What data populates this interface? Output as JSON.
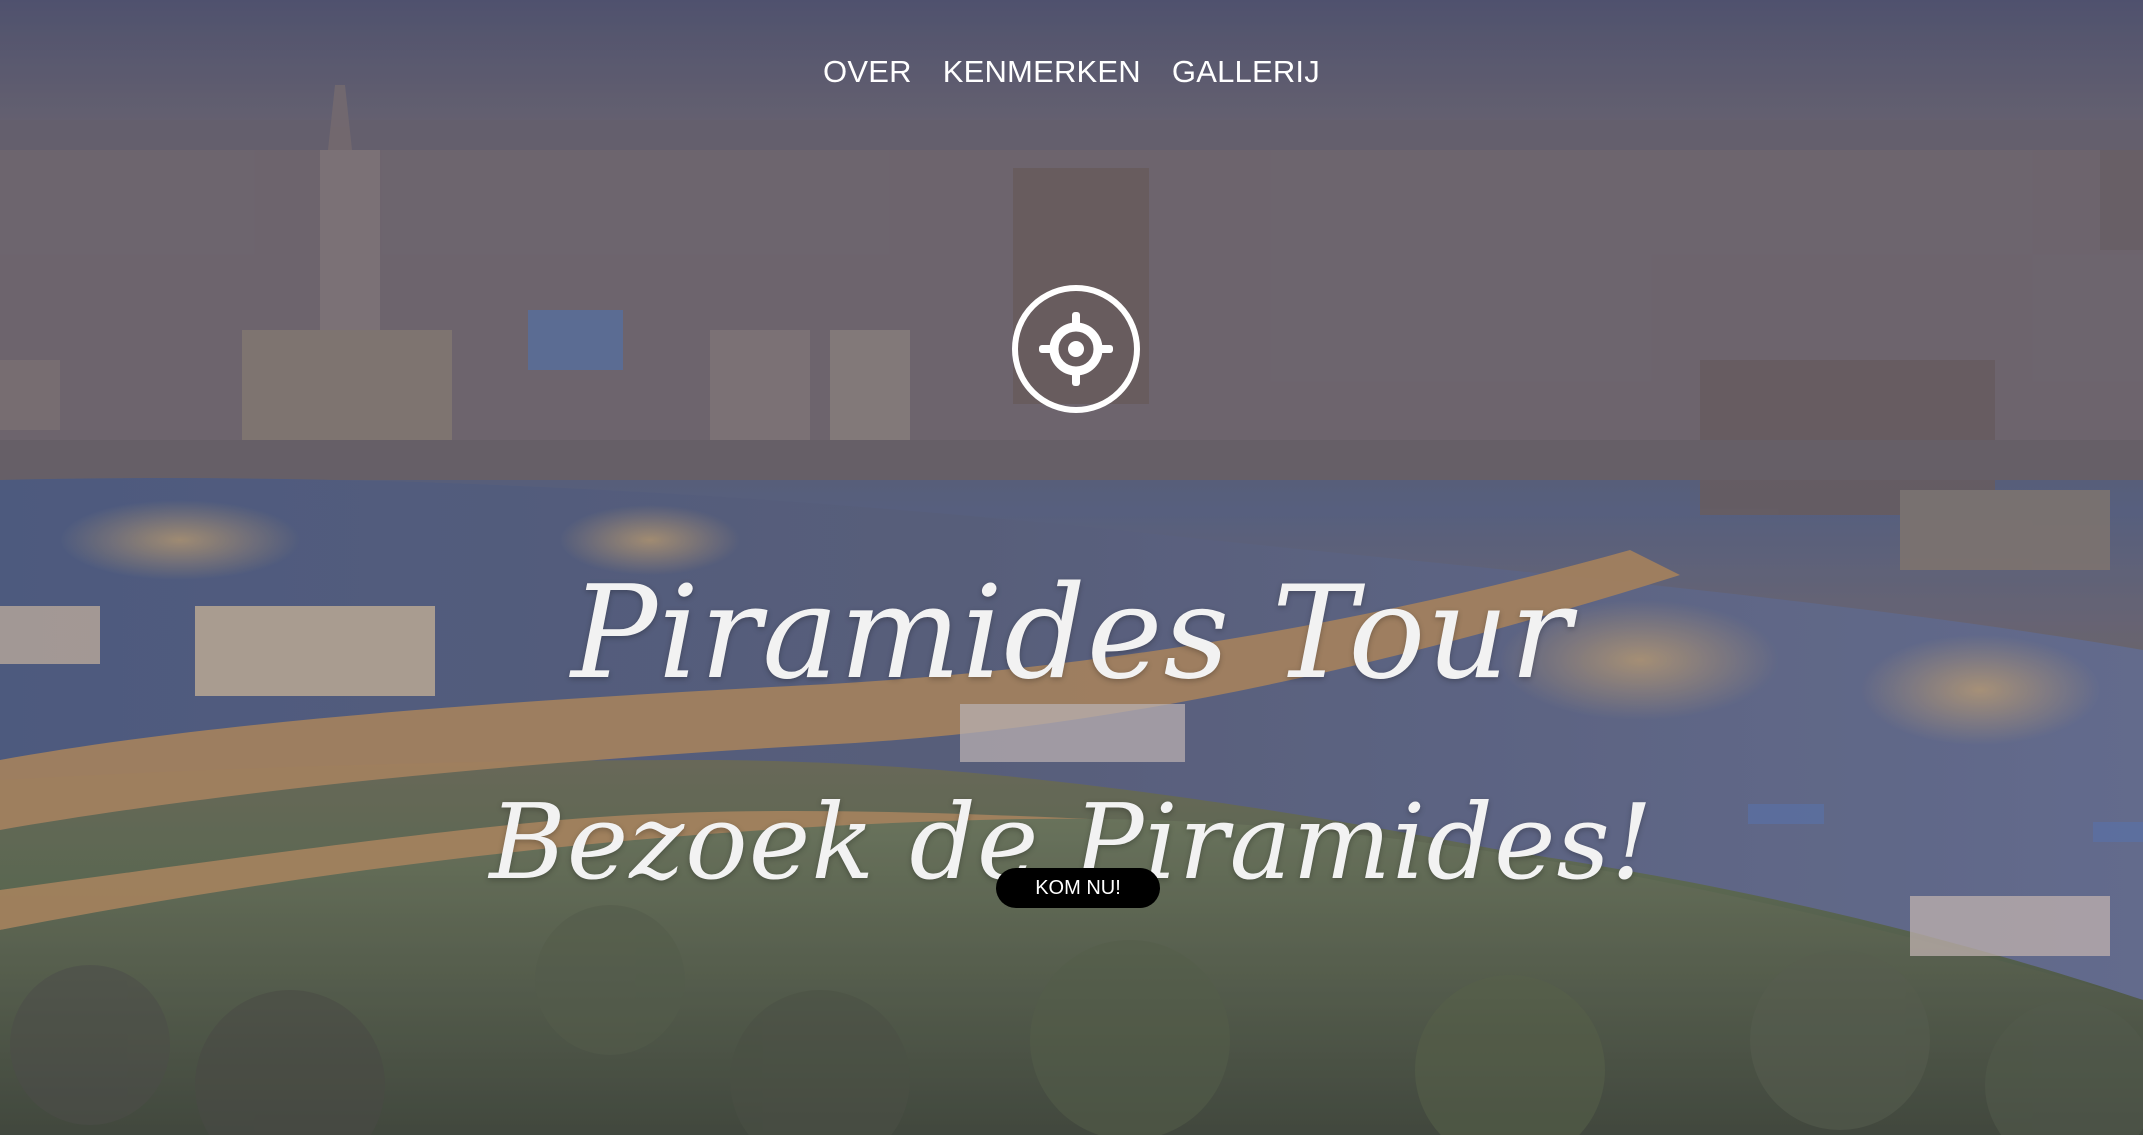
{
  "nav": {
    "items": [
      {
        "label": "OVER"
      },
      {
        "label": "KENMERKEN"
      },
      {
        "label": "GALLERIJ"
      }
    ]
  },
  "hero": {
    "title": "Piramides Tour",
    "subtitle": "Bezoek de Piramides!",
    "cta_label": "KOM NU!",
    "logo_icon": "target-icon"
  },
  "colors": {
    "text": "#ffffff",
    "button_background": "#000000"
  }
}
